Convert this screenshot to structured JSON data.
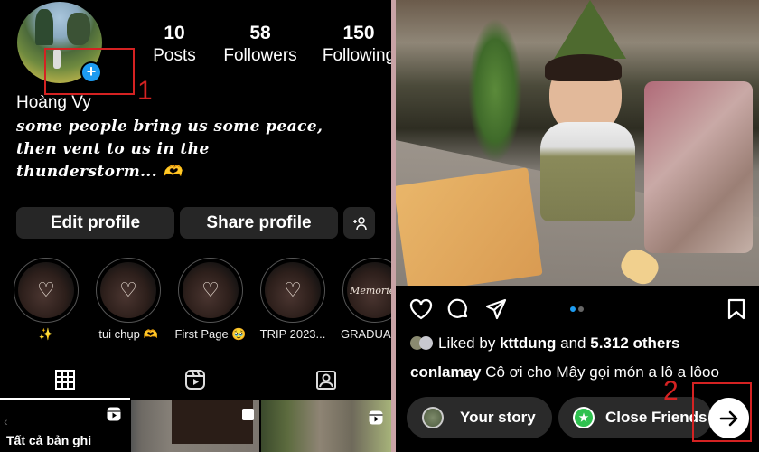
{
  "profile": {
    "name": "Hoàng Vy",
    "bio_lines": [
      "some people bring us some peace,",
      "then vent to us in the",
      "thunderstorm... 🫶"
    ],
    "stats": [
      {
        "value": "10",
        "label": "Posts"
      },
      {
        "value": "58",
        "label": "Followers"
      },
      {
        "value": "150",
        "label": "Following"
      }
    ],
    "edit_profile_label": "Edit profile",
    "share_profile_label": "Share profile",
    "highlights": [
      {
        "label": "✨",
        "icon": "heart-icon"
      },
      {
        "label": "tui chụp 🫶",
        "icon": "cloud-heart-icon"
      },
      {
        "label": "First Page 🥹",
        "icon": "cloud-heart-icon"
      },
      {
        "label": "TRIP 2023...",
        "icon": "cloud-heart-icon"
      },
      {
        "label": "GRADUA",
        "icon": "memories-text"
      }
    ],
    "highlight_memories_text": "Memories",
    "tabs": [
      "grid-icon",
      "reels-icon",
      "tagged-icon"
    ],
    "grid_first_cell_title": "Tất cả bản ghi"
  },
  "annotations": {
    "mark1": "1",
    "mark2": "2",
    "color": "#d42222"
  },
  "post": {
    "liked_by_prefix": "Liked by",
    "liked_by_user": "kttdung",
    "liked_by_and": "and",
    "liked_by_count": "5.312 others",
    "caption_user": "conlamay",
    "caption_text": "Cô ơi cho Mây gọi món a lô a lôoo",
    "share": {
      "your_story_label": "Your story",
      "close_friends_label": "Close Friends"
    }
  },
  "colors": {
    "accent_blue": "#1d9bf0",
    "close_friends_green": "#2fc14f",
    "button_bg": "#262626"
  }
}
